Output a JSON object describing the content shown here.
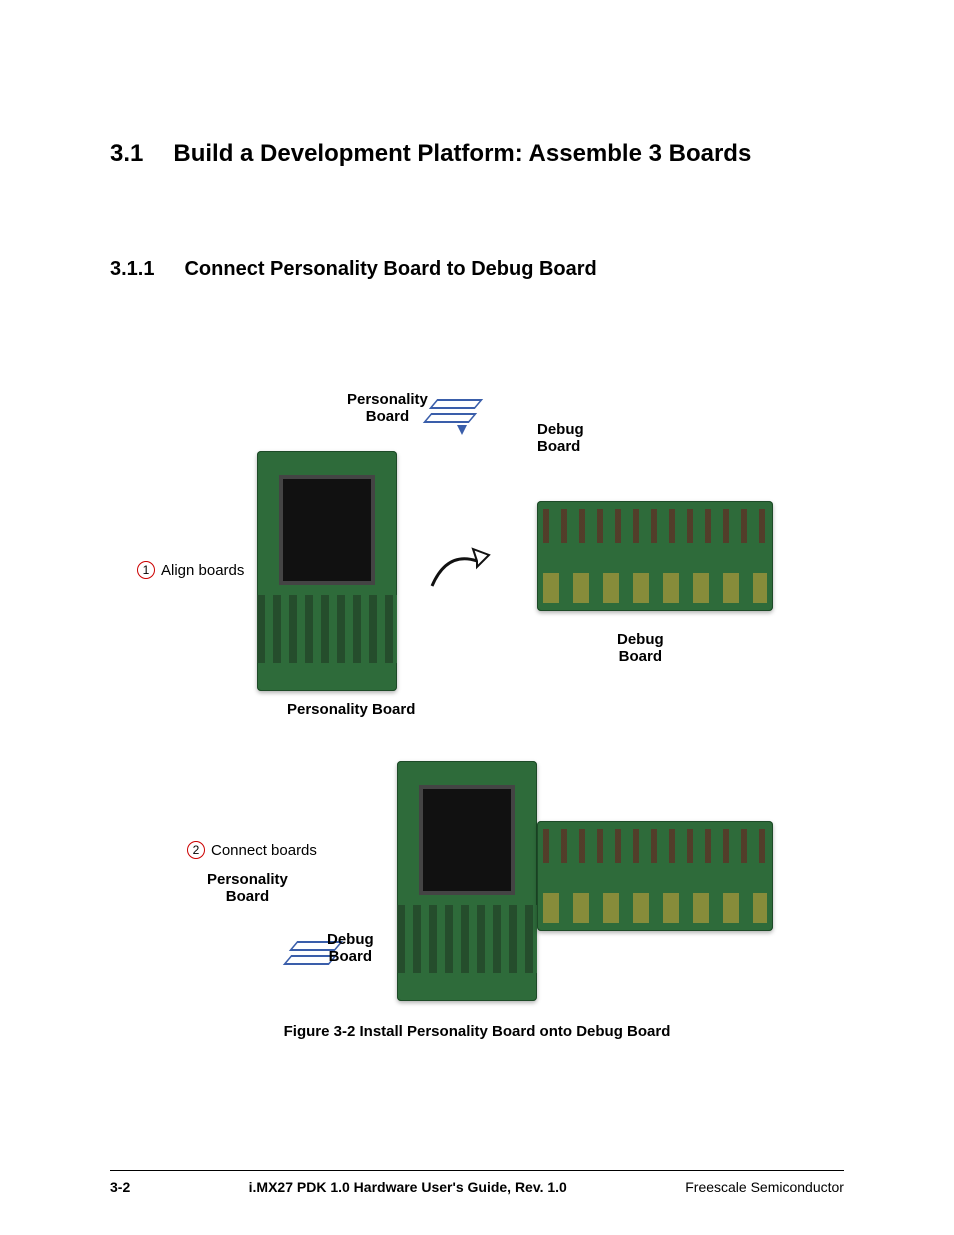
{
  "headings": {
    "h1_num": "3.1",
    "h1_text": "Build a Development Platform: Assemble 3 Boards",
    "h2_num": "3.1.1",
    "h2_text": "Connect Personality Board to Debug Board"
  },
  "figure": {
    "label_personality_top1": "Personality",
    "label_personality_top2": "Board",
    "label_debug_top1": "Debug",
    "label_debug_top2": "Board",
    "step1_num": "1",
    "step1_text": "Align boards",
    "label_personality_cap": "Personality Board",
    "label_debug_cap1": "Debug",
    "label_debug_cap2": "Board",
    "step2_num": "2",
    "step2_text": "Connect boards",
    "stack_lbl_p1": "Personality",
    "stack_lbl_p2": "Board",
    "stack_lbl_d1": "Debug",
    "stack_lbl_d2": "Board",
    "caption": "Figure 3-2 Install Personality Board onto Debug Board"
  },
  "footer": {
    "page": "3-2",
    "center": "i.MX27 PDK 1.0 Hardware User's Guide, Rev. 1.0",
    "right": "Freescale Semiconductor"
  }
}
